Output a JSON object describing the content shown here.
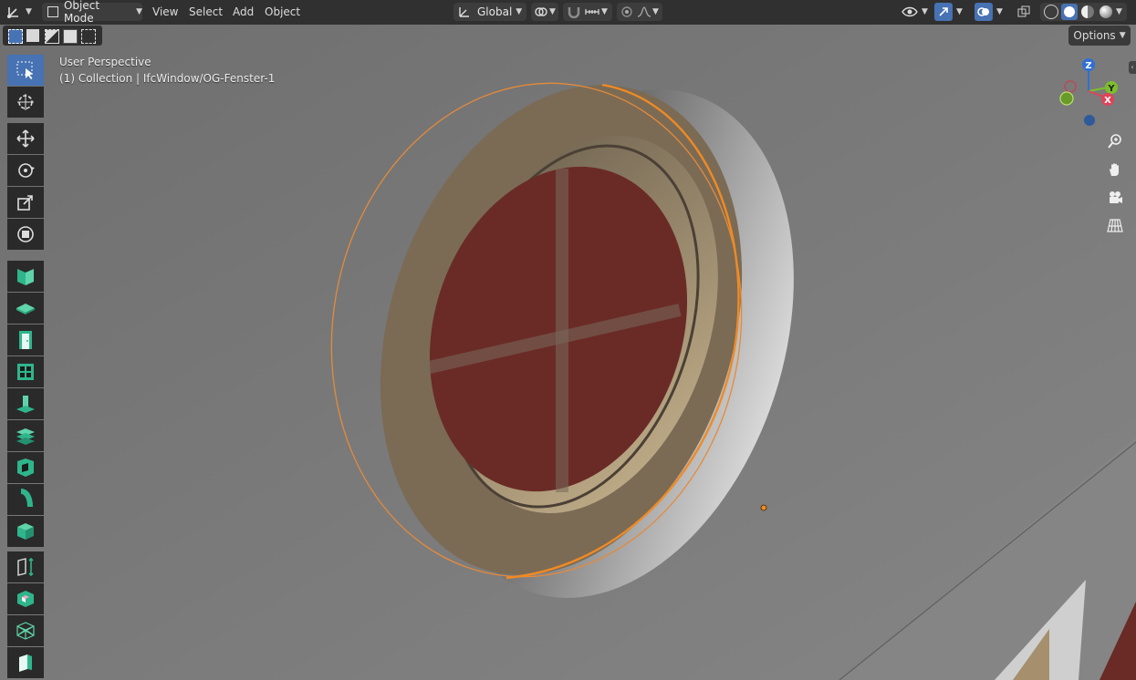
{
  "header": {
    "mode_label": "Object Mode",
    "menus": [
      "View",
      "Select",
      "Add",
      "Object"
    ],
    "transform_orientation": "Global"
  },
  "viewport": {
    "perspective_label": "User Perspective",
    "collection_label": "(1) Collection | IfcWindow/OG-Fenster-1",
    "options_label": "Options"
  },
  "gizmo": {
    "z": "Z",
    "y": "Y",
    "x": "X"
  },
  "colors": {
    "header_bg": "#303030",
    "active_tool": "#4772b3",
    "selection_outline": "#f08a24",
    "frame": "#7a6a55",
    "glass": "#6b2b26",
    "bim_tool": "#2fb58b"
  },
  "icons": {
    "toolbar": [
      "select-box-icon",
      "cursor-icon",
      "move-icon",
      "rotate-icon",
      "scale-icon",
      "transform-icon",
      "wall-tool-icon",
      "slab-tool-icon",
      "door-tool-icon",
      "window-tool-icon",
      "column-tool-icon",
      "stair-tool-icon",
      "opening-tool-icon",
      "pipe-tool-icon",
      "generic-element-icon",
      "measure-icon",
      "spatial-icon",
      "structural-icon",
      "covering-icon"
    ]
  }
}
